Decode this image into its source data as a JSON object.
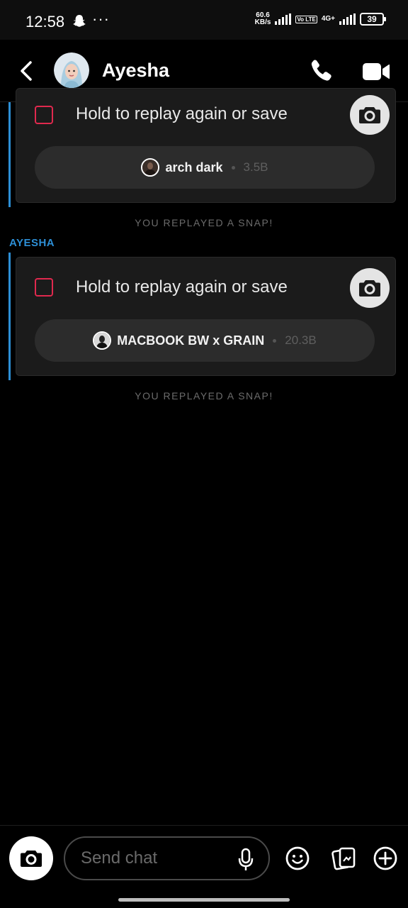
{
  "status_bar": {
    "time": "12:58",
    "dots": "···",
    "net_speed_value": "60.6",
    "net_speed_unit": "KB/s",
    "volte": "Vo LTE",
    "network": "4G+",
    "battery": "39"
  },
  "header": {
    "contact_name": "Ayesha"
  },
  "messages": [
    {
      "prompt": "Hold to replay again or save",
      "lens_name": "arch dark",
      "lens_size": "3.5B",
      "system_note": "YOU REPLAYED A SNAP!"
    },
    {
      "sender": "AYESHA",
      "prompt": "Hold to replay again or save",
      "lens_name": "MACBOOK BW x GRAIN",
      "lens_size": "20.3B",
      "system_note": "YOU REPLAYED A SNAP!"
    }
  ],
  "composer": {
    "placeholder": "Send chat"
  },
  "colors": {
    "accent_blue": "#2d8fd6",
    "checkbox_red": "#e0294e",
    "card_bg": "#1b1b1b"
  },
  "icons": [
    "snapchat-ghost-icon",
    "back-chevron-icon",
    "phone-icon",
    "video-camera-icon",
    "camera-icon",
    "microphone-icon",
    "emoji-icon",
    "memories-icon",
    "plus-circle-icon"
  ]
}
